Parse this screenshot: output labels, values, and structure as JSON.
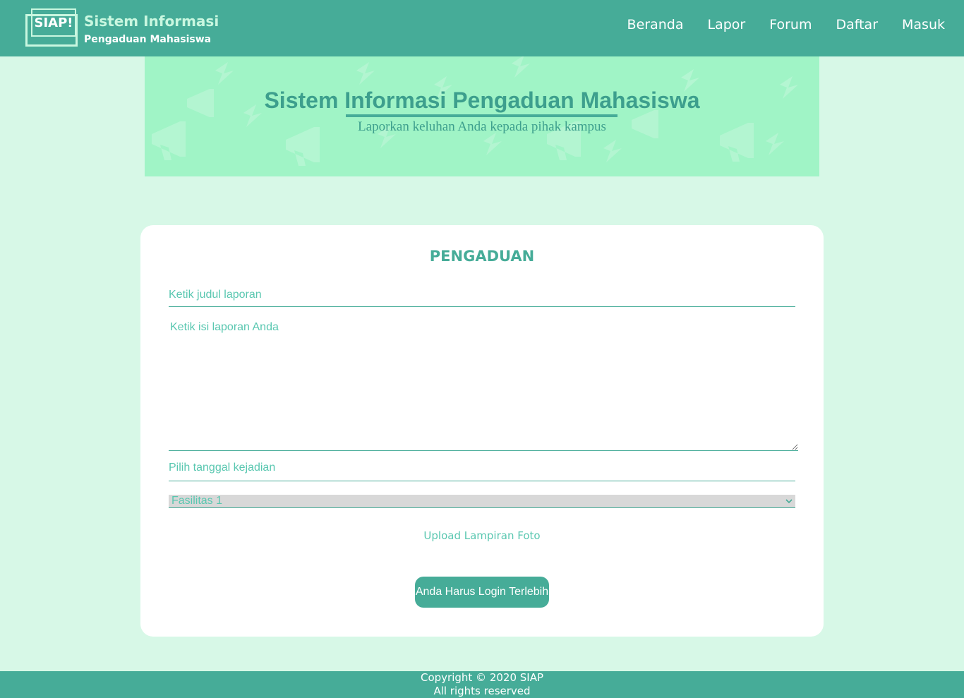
{
  "header": {
    "logo_text": "SIAP!",
    "logo_title": "Sistem Informasi",
    "logo_subtitle": "Pengaduan Mahasiswa",
    "nav": [
      "Beranda",
      "Lapor",
      "Forum",
      "Daftar",
      "Masuk"
    ]
  },
  "banner": {
    "title": "Sistem Informasi Pengaduan Mahasiswa",
    "subtitle": "Laporkan keluhan Anda kepada pihak kampus"
  },
  "form": {
    "title": "PENGADUAN",
    "title_placeholder": "Ketik judul laporan",
    "body_placeholder": "Ketik isi laporan Anda",
    "date_placeholder": "Pilih tanggal kejadian",
    "category_selected": "Fasilitas 1",
    "upload_label": "Upload Lampiran Foto",
    "submit_label": "Anda Harus Login Terlebih"
  },
  "footer": {
    "copyright": "Copyright © 2020 SIAP",
    "rights": "All rights reserved"
  },
  "colors": {
    "primary": "#46ac98",
    "banner_bg": "#a0f4c6",
    "page_bg": "#d7f8e7"
  }
}
